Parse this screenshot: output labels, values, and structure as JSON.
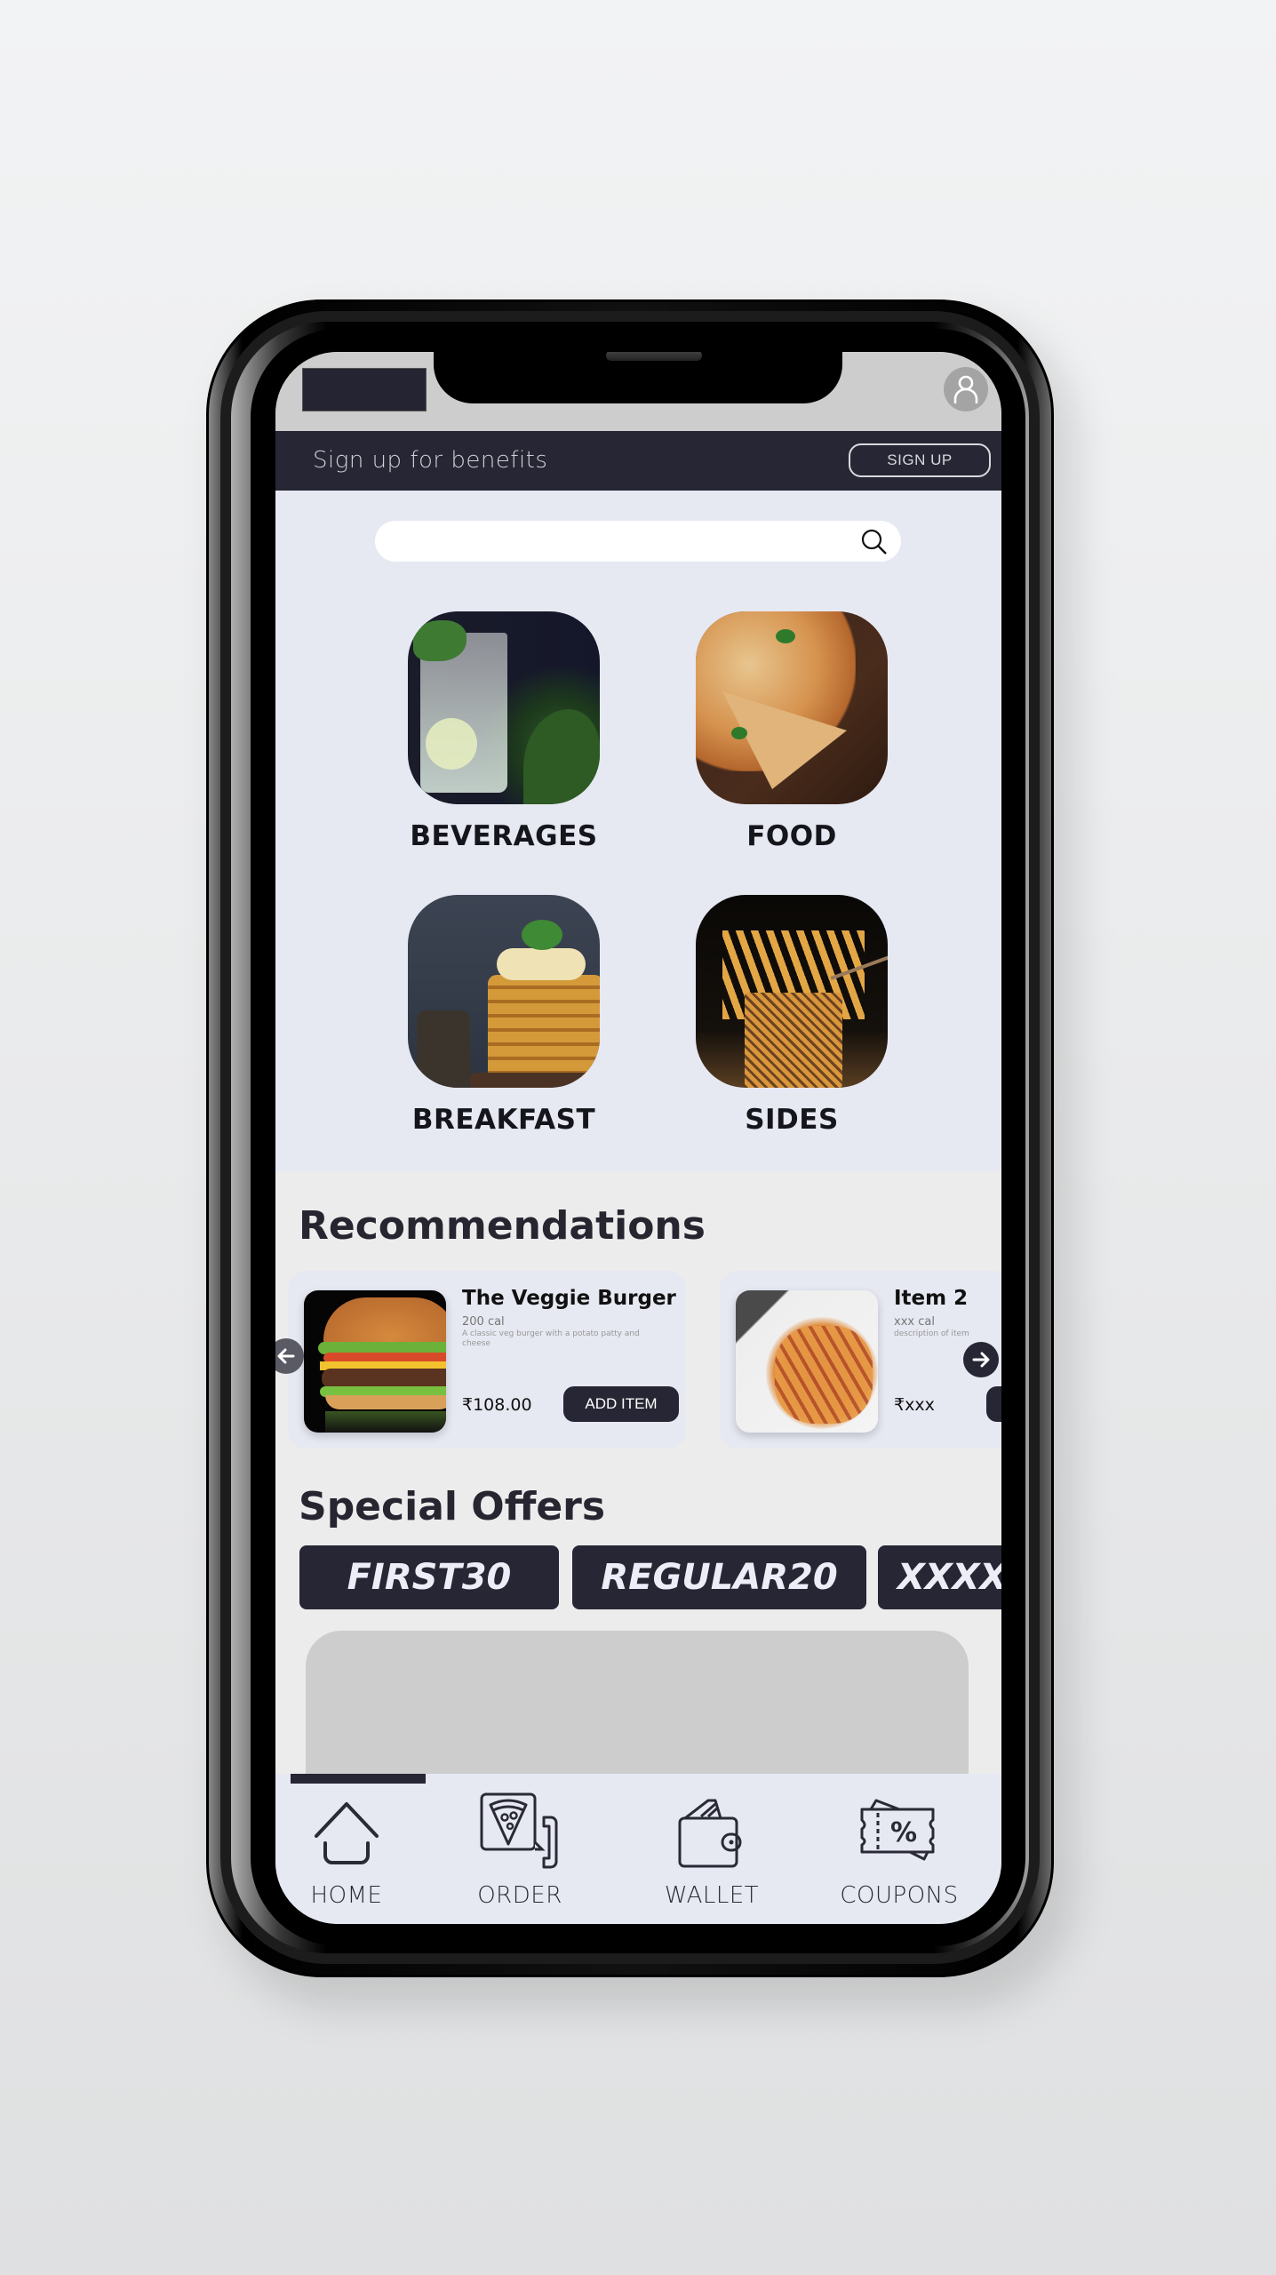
{
  "status_bar": {
    "profile_icon": "user-icon"
  },
  "signup_banner": {
    "text": "Sign up for benefits",
    "button_label": "SIGN UP"
  },
  "search": {
    "placeholder": "",
    "value": "",
    "icon": "search-icon"
  },
  "categories": [
    {
      "label": "BEVERAGES",
      "image": "mojito-drink"
    },
    {
      "label": "FOOD",
      "image": "pizza"
    },
    {
      "label": "BREAKFAST",
      "image": "pancakes"
    },
    {
      "label": "SIDES",
      "image": "french-fries"
    }
  ],
  "recommendations": {
    "title": "Recommendations",
    "items": [
      {
        "name": "The Veggie Burger",
        "calories": "200 cal",
        "description": "A classic veg burger with a potato patty and cheese",
        "price": "₹108.00",
        "button_label": "ADD ITEM",
        "image": "burger"
      },
      {
        "name": "Item 2",
        "calories": "xxx cal",
        "description": "description of item",
        "price": "₹xxx",
        "button_label": "",
        "image": "penne-pasta"
      }
    ],
    "prev_icon": "arrow-left-icon",
    "next_icon": "arrow-right-icon"
  },
  "special_offers": {
    "title": "Special Offers",
    "coupons": [
      "FIRST30",
      "REGULAR20",
      "XXXX"
    ]
  },
  "bottom_nav": {
    "active_index": 0,
    "items": [
      {
        "label": "HOME",
        "icon": "home-icon"
      },
      {
        "label": "ORDER",
        "icon": "order-phone-icon"
      },
      {
        "label": "WALLET",
        "icon": "wallet-icon"
      },
      {
        "label": "COUPONS",
        "icon": "coupon-icon"
      }
    ]
  },
  "colors": {
    "primary_dark": "#272634",
    "surface_light": "#e6e8f2",
    "status_grey": "#cdcdcd",
    "text_dark": "#15151c"
  }
}
